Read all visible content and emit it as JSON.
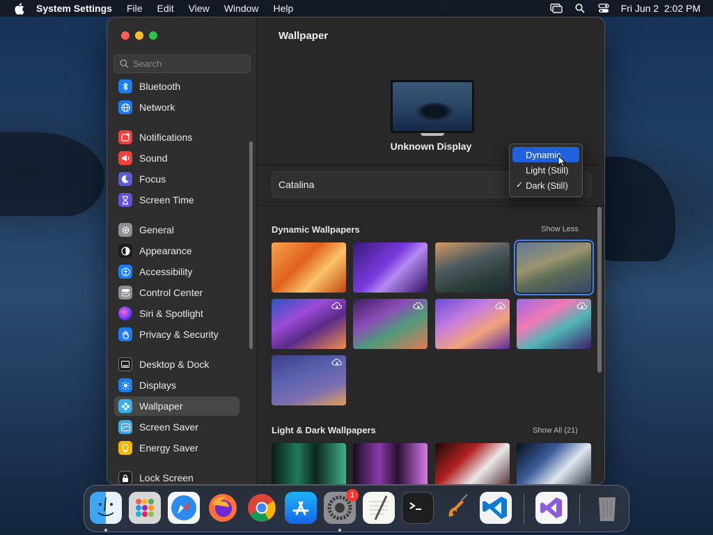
{
  "menubar": {
    "apple_icon": "apple-logo-icon",
    "app_name": "System Settings",
    "menus": [
      "File",
      "Edit",
      "View",
      "Window",
      "Help"
    ],
    "datetime": "Fri Jun 2  2:02 PM"
  },
  "sidebar": {
    "search_placeholder": "Search",
    "items": [
      {
        "label": "Bluetooth",
        "icon": "bluetooth-icon",
        "color": "#1e7cf2"
      },
      {
        "label": "Network",
        "icon": "globe-icon",
        "color": "#1e7cf2"
      },
      {
        "label": "Notifications",
        "icon": "notifications-icon",
        "color": "#f0413d"
      },
      {
        "label": "Sound",
        "icon": "speaker-icon",
        "color": "#f0413d"
      },
      {
        "label": "Focus",
        "icon": "moon-icon",
        "color": "#5b5bd6"
      },
      {
        "label": "Screen Time",
        "icon": "hourglass-icon",
        "color": "#6a4fd8"
      },
      {
        "label": "General",
        "icon": "gear-icon",
        "color": "#8e8e93"
      },
      {
        "label": "Appearance",
        "icon": "appearance-icon",
        "color": "#1c1c1e"
      },
      {
        "label": "Accessibility",
        "icon": "accessibility-icon",
        "color": "#1e7cf2"
      },
      {
        "label": "Control Center",
        "icon": "toggles-icon",
        "color": "#8e8e93"
      },
      {
        "label": "Siri & Spotlight",
        "icon": "siri-icon",
        "color": "#b33fd4"
      },
      {
        "label": "Privacy & Security",
        "icon": "hand-icon",
        "color": "#1e7cf2"
      },
      {
        "label": "Desktop & Dock",
        "icon": "dock-icon",
        "color": "#1c1c1e"
      },
      {
        "label": "Displays",
        "icon": "sun-icon",
        "color": "#1e7cf2"
      },
      {
        "label": "Wallpaper",
        "icon": "wallpaper-icon",
        "color": "#3aaee8"
      },
      {
        "label": "Screen Saver",
        "icon": "screensaver-icon",
        "color": "#3aaee8"
      },
      {
        "label": "Energy Saver",
        "icon": "battery-icon",
        "color": "#f5b800"
      },
      {
        "label": "Lock Screen",
        "icon": "lock-icon",
        "color": "#1c1c1e"
      }
    ],
    "active_label": "Wallpaper"
  },
  "main": {
    "title": "Wallpaper",
    "display_name": "Unknown Display",
    "wallpaper_name": "Catalina",
    "dynamic_section": {
      "title": "Dynamic Wallpapers",
      "link": "Show Less"
    },
    "lightdark_section": {
      "title": "Light & Dark Wallpapers",
      "link": "Show All (21)"
    }
  },
  "popup": {
    "options": [
      "Dynamic",
      "Light (Still)",
      "Dark (Still)"
    ],
    "highlighted": "Dynamic",
    "checked": "Dark (Still)"
  },
  "dock": {
    "apps": [
      "finder-icon",
      "launchpad-icon",
      "safari-icon",
      "firefox-icon",
      "chrome-icon",
      "app-store-icon",
      "system-settings-icon",
      "textedit-icon",
      "terminal-icon",
      "garageband-icon",
      "vscode-icon",
      "visual-studio-icon",
      "trash-icon"
    ],
    "settings_badge": "1"
  }
}
